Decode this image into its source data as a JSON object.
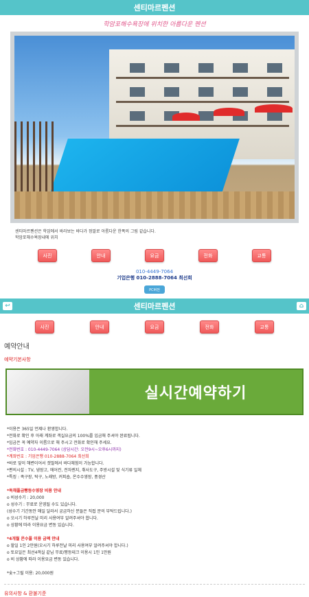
{
  "header": {
    "title": "센티마르펜션"
  },
  "subtitle": "학암포해수욕장에 위치한 아름다운 펜션",
  "caption": {
    "line1": "센티마르펜션은 학암에서 바라보는 바다가 정말로 아름다운 한폭의 그림 같습니다.",
    "line2": "학암포해수욕장내에 위치"
  },
  "nav": [
    "사진",
    "안내",
    "요금",
    "전화",
    "교통"
  ],
  "contact": {
    "phone": "010-4449-7064",
    "bank": "기업은행 010-2888-7064 최선희",
    "pc_button": "PC버전"
  },
  "header2": {
    "title": "센티마르펜션",
    "back_icon": "↩",
    "home_icon": "⌂"
  },
  "section": {
    "title": "예약안내",
    "subtitle": "예약기본사항"
  },
  "banner": {
    "text": "실시간예약하기"
  },
  "info_lines": [
    "*이용은 365일 언제나 환영합니다.",
    "*전화로 확인 후 아래 계좌로 객실요금의 100%를 입금해 주셔야 완료됩니다.",
    "*입금은 꼭 예약자 이름으로 해 주시고 전화로 확인해 주세요.",
    "*전화번호 : 010-4449-7064 (상담시간: 오전9시~오후6시까지)",
    "*계좌번호 : 기업은행 010-2888-7064 최선희",
    "*바로 앞이 해변이어서 갯벌에서 바다체험이 가능합니다.",
    "*편의시설 : TV, 냉장고, 에어컨, 전자렌지, 취사도구, 주방시설 및 식기류 일체",
    "*특징 : 족구장, 탁구, 노래방, 커피숍, 온수수영장, 풍경산"
  ],
  "notice1": {
    "head": "*독채풀금빵등수영장 비용 안내",
    "lines": [
      "o 비성수기 : 20,000",
      "o 성수기 : 무료로 운영될 수도 있습니다.",
      "(성수기 기간동안 매일 달라서 궁금하신 분들은 직접 문의 부탁드립니다.)",
      "o 오시기 하루전날 미리 사용여부 알려주셔야 합니다.",
      "o 상황에 따라 이용요금 변동 있습니다."
    ]
  },
  "notice2": {
    "head": "*4개월 온수풀 이용 금액 안내",
    "lines": [
      "o 할일 1인 2만원(오시기 하루전날 미리 사용여부 알려주셔야 합니다.)",
      "o 토요일은 최선4객실 같님 무료/평등테크 이용시 1인 1만원",
      "o 비 상황에 따라 이용요금 변동 있습니다."
    ]
  },
  "bbq": "*숯+그릴 이용: 20,000원",
  "footer": {
    "title": "유의사항 & 환불기준"
  }
}
